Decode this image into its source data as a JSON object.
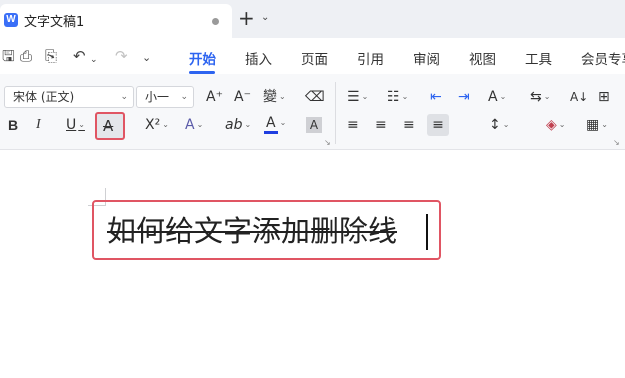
{
  "window": {
    "logo_letter": "W",
    "tab_title": "文字文稿1",
    "new_tab": "+",
    "more": "⌄"
  },
  "quick_access": {
    "save": "🖫",
    "print": "⎙",
    "print_preview": "⎘",
    "undo": "↶",
    "redo": "↷",
    "more": "⌄"
  },
  "menu": {
    "tabs": [
      "开始",
      "插入",
      "页面",
      "引用",
      "审阅",
      "视图",
      "工具",
      "会员专享"
    ],
    "active": "开始"
  },
  "ribbon": {
    "font_name": "宋体 (正文)",
    "font_size": "小一",
    "grow_font": "A⁺",
    "shrink_font": "A⁻",
    "phonetic": "變",
    "clear_format": "⌫",
    "bold": "B",
    "italic": "I",
    "underline": "U",
    "strikethrough": "A",
    "superscript": "X²",
    "text_effect": "A",
    "highlight": "ab",
    "font_color": "A",
    "char_shading": "A",
    "bullets": "☰",
    "numbering": "☷",
    "decrease_indent": "⇤",
    "increase_indent": "⇥",
    "chinese_layout": "A",
    "text_direction": "⇆",
    "sort": "A↓",
    "columns": "⊞",
    "align_left": "≡",
    "align_center": "≡",
    "align_right": "≡",
    "justify": "≡",
    "line_spacing": "↕",
    "shading": "◈",
    "borders": "▦",
    "dialog_launcher": "↘"
  },
  "document": {
    "text": "如何给文字添加删除线"
  },
  "colors": {
    "accent": "#2d64f0",
    "highlight_border": "#e05563",
    "font_color_bar": "#1f3ee0"
  }
}
